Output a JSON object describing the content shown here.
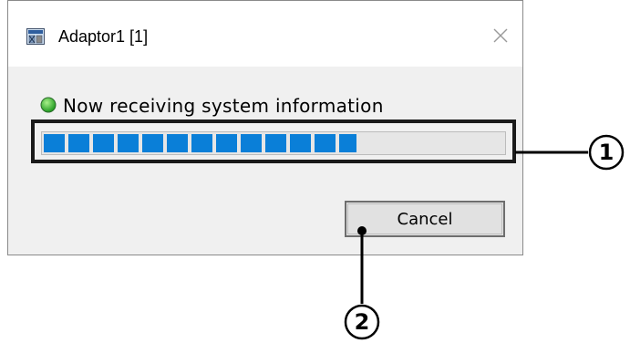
{
  "window": {
    "title": "Adaptor1 [1]",
    "icon": "adaptor-app-icon",
    "close_icon": "close-icon"
  },
  "status": {
    "indicator_color": "#33b233",
    "text": "Now receiving system information"
  },
  "progress": {
    "value_percent": 68,
    "color": "#0a7fd8"
  },
  "buttons": {
    "cancel_label": "Cancel"
  },
  "callouts": [
    {
      "label": "①"
    },
    {
      "label": "②"
    }
  ]
}
